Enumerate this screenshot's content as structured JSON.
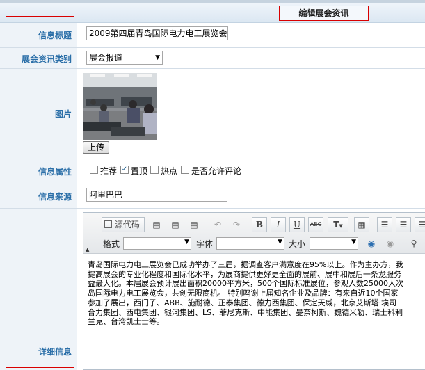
{
  "header": {
    "title": "编辑展会资讯"
  },
  "form": {
    "title_label": "信息标题",
    "title_value": "2009第四届青岛国际电力电工展览会",
    "category_label": "展会资讯类别",
    "category_value": "展会报道",
    "image_label": "图片",
    "upload_button": "上传",
    "attributes_label": "信息属性",
    "attributes": [
      {
        "label": "推荐",
        "checked": false
      },
      {
        "label": "置顶",
        "checked": true
      },
      {
        "label": "热点",
        "checked": false
      },
      {
        "label": "是否允许评论",
        "checked": false
      }
    ],
    "source_label": "信息来源",
    "source_value": "阿里巴巴",
    "detail_label": "详细信息"
  },
  "editor": {
    "source_button": "源代码",
    "format_label": "格式",
    "font_label": "字体",
    "size_label": "大小",
    "bold": "B",
    "italic": "I",
    "underline": "U",
    "strike": "ABC",
    "text_color": "T",
    "content_lines": [
      "青岛国际电力电工展览会已成功举办了三届，据调查客户满意度在95%以上。作为主办方，我",
      "提高展会的专业化程度和国际化水平，为展商提供更好更全面的展前、展中和展后一条龙服务",
      "益最大化。本届展会预计展出面积20000平方米，500个国际标准展位，参观人数25000人次",
      "岛国际电力电工展览会，共创无限商机。 特别鸣谢上届知名企业及品牌：有来自近10个国家",
      "参加了展出，西门子、ABB、施耐德、正泰集团、德力西集团、保定天威，北京艾斯塔·埃司",
      "合力集团、西电集团、银河集团、LS、菲尼克斯、中能集团、曼奈柯斯、魏德米勒、瑞士科利",
      "兰克、台湾凯士士等。"
    ]
  }
}
